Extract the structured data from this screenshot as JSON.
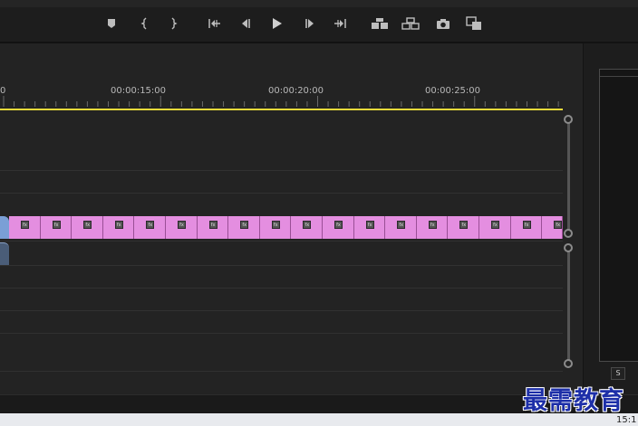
{
  "transport": {
    "buttons": [
      {
        "name": "add-marker-icon"
      },
      {
        "name": "mark-in-icon"
      },
      {
        "name": "mark-out-icon"
      },
      {
        "name": "go-to-in-icon"
      },
      {
        "name": "step-back-icon"
      },
      {
        "name": "play-icon"
      },
      {
        "name": "step-forward-icon"
      },
      {
        "name": "go-to-out-icon"
      },
      {
        "name": "lift-icon"
      },
      {
        "name": "extract-icon"
      },
      {
        "name": "export-frame-icon"
      },
      {
        "name": "comparison-view-icon"
      }
    ]
  },
  "timeline": {
    "ruler_labels": [
      "0",
      "00:00:15:00",
      "00:00:20:00",
      "00:00:25:00"
    ],
    "playhead_color": "#e6d93a",
    "clip_color": "#e48ee0",
    "clip_fx_label": "fx",
    "clip_count": 18
  },
  "right_panel": {
    "s_button": "S"
  },
  "watermark": "最需教育",
  "taskbar": {
    "clock": "15:1"
  }
}
